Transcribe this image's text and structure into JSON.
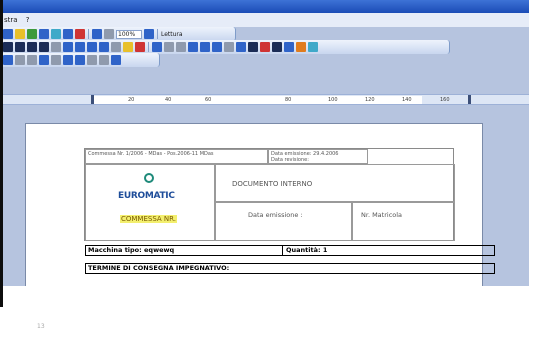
{
  "menu": {
    "item1": "stra",
    "item2": "?"
  },
  "toolbar": {
    "zoom_value": "100%",
    "read_label": "Lettura"
  },
  "ruler": {
    "labels": [
      "20",
      "40",
      "60",
      "80",
      "100",
      "120",
      "140",
      "160"
    ]
  },
  "document": {
    "header_line1": "Commessa Nr. 1/2006 - MDas - Pos.2006-11 MDas",
    "header_line1_right": "Data emissione: 29.4.2006",
    "header_line1_right2": "Data revisione:",
    "logo_text": "EUROMATIC",
    "doc_title": "DOCUMENTO INTERNO",
    "commessa_label": "COMMESSA NR.",
    "data_emissione_label": "Data emissione :",
    "matricola_label": "Nr. Matricola",
    "machine_label": "Macchina tipo: eqwewq",
    "quantity_label": "Quantità: 1",
    "delivery_label": "TERMINE DI CONSEGNA IMPEGNATIVO:"
  },
  "slide": {
    "number": "13"
  },
  "colors": {
    "titlebar": "#1b4cb6",
    "highlight": "#f3ef6e",
    "toolbar": "#c8d6ef"
  }
}
